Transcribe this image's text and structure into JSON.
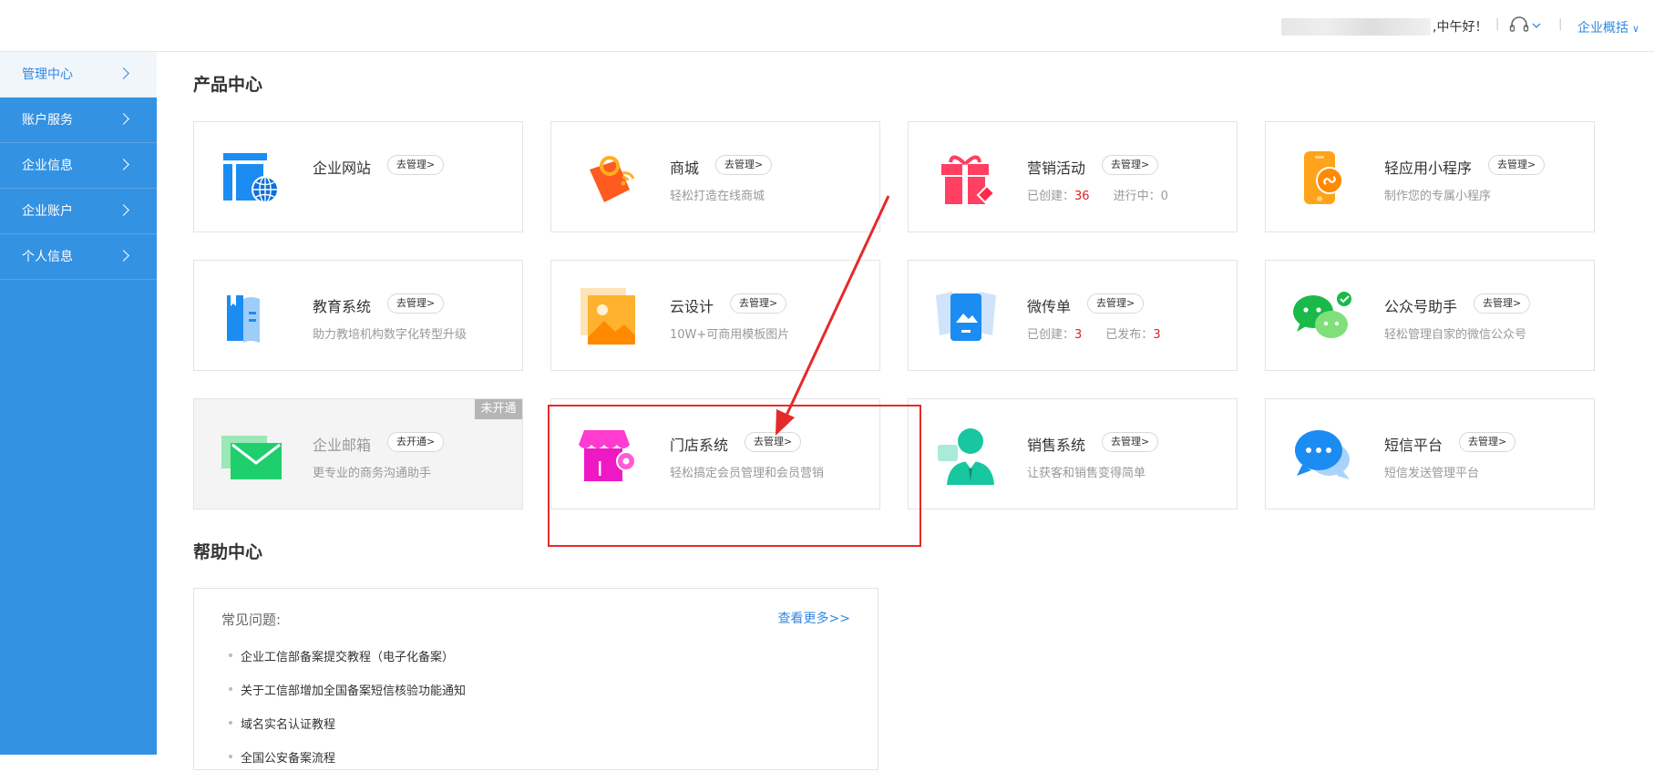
{
  "topbar": {
    "greeting": ",中午好！",
    "separator": "|",
    "overview": "企业概括",
    "chevron": "∨"
  },
  "sidebar": {
    "items": [
      {
        "label": "管理中心"
      },
      {
        "label": "账户服务"
      },
      {
        "label": "企业信息"
      },
      {
        "label": "企业账户"
      },
      {
        "label": "个人信息"
      }
    ]
  },
  "sections": {
    "products_title": "产品中心",
    "help_title": "帮助中心"
  },
  "products": [
    {
      "name": "企业网站",
      "button": "去管理>",
      "desc": "",
      "icon": "website-icon"
    },
    {
      "name": "商城",
      "button": "去管理>",
      "desc": "轻松打造在线商城",
      "icon": "mall-icon"
    },
    {
      "name": "营销活动",
      "button": "去管理>",
      "desc_created_label": "已创建：",
      "desc_created_value": "36",
      "desc_progress_label": "进行中：",
      "desc_progress_value": "0",
      "icon": "gift-icon"
    },
    {
      "name": "轻应用小程序",
      "button": "去管理>",
      "desc": "制作您的专属小程序",
      "icon": "mini-program-icon"
    },
    {
      "name": "教育系统",
      "button": "去管理>",
      "desc": "助力教培机构数字化转型升级",
      "icon": "education-icon"
    },
    {
      "name": "云设计",
      "button": "去管理>",
      "desc": "10W+可商用模板图片",
      "icon": "cloud-design-icon"
    },
    {
      "name": "微传单",
      "button": "去管理>",
      "desc_created_label": "已创建：",
      "desc_created_value": "3",
      "desc_published_label": "已发布：",
      "desc_published_value": "3",
      "icon": "flyer-icon"
    },
    {
      "name": "公众号助手",
      "button": "去管理>",
      "desc": "轻松管理自家的微信公众号",
      "icon": "wechat-icon"
    },
    {
      "name": "企业邮箱",
      "button": "去开通>",
      "desc": "更专业的商务沟通助手",
      "ribbon": "未开通",
      "icon": "mail-icon"
    },
    {
      "name": "门店系统",
      "button": "去管理>",
      "desc": "轻松搞定会员管理和会员营销",
      "icon": "store-icon"
    },
    {
      "name": "销售系统",
      "button": "去管理>",
      "desc": "让获客和销售变得简单",
      "icon": "sales-icon"
    },
    {
      "name": "短信平台",
      "button": "去管理>",
      "desc": "短信发送管理平台",
      "icon": "sms-icon"
    }
  ],
  "help": {
    "faq_title": "常见问题:",
    "more": "查看更多>>",
    "items": [
      "企业工信部备案提交教程（电子化备案）",
      "关于工信部增加全国备案短信核验功能通知",
      "域名实名认证教程",
      "全国公安备案流程"
    ]
  },
  "colors": {
    "sidebar_bg": "#3492e3",
    "accent": "#3189e1",
    "highlight": "#e52a2a",
    "number_red": "#e02020"
  }
}
